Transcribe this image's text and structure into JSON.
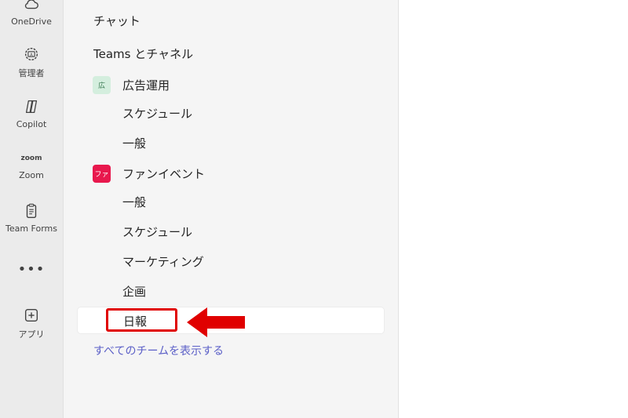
{
  "rail": {
    "onedrive": "OneDrive",
    "admin": "管理者",
    "copilot": "Copilot",
    "zoom_logo": "zoom",
    "zoom": "Zoom",
    "team_forms": "Team Forms",
    "more": "•••",
    "apps": "アプリ"
  },
  "panel": {
    "chat": "チャット",
    "teams_and_channels": "Teams とチャネル",
    "teams": [
      {
        "avatar_text": "広",
        "name": "広告運用",
        "channels": [
          "スケジュール",
          "一般"
        ]
      },
      {
        "avatar_text": "ファ",
        "name": "ファンイベント",
        "channels": [
          "一般",
          "スケジュール",
          "マーケティング",
          "企画",
          "日報"
        ]
      }
    ],
    "show_all_teams": "すべてのチームを表示する"
  },
  "colors": {
    "accent_link": "#5b5fc7",
    "highlight_red": "#e00000",
    "team_pink": "#e8184d",
    "team_green": "#d4eede"
  }
}
